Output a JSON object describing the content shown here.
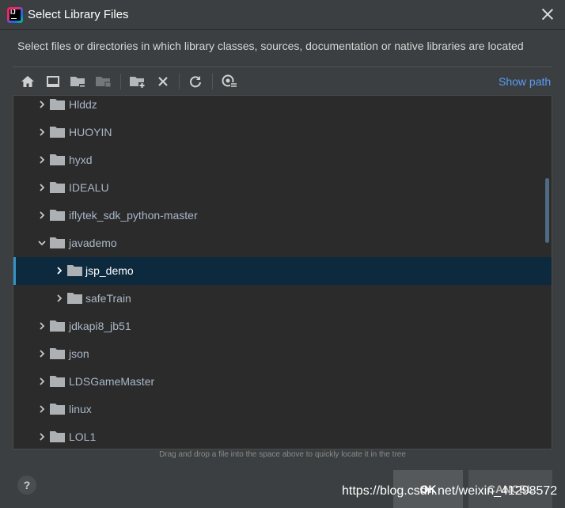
{
  "window": {
    "title": "Select Library Files",
    "description": "Select files or directories in which library classes, sources, documentation or native libraries are located"
  },
  "toolbar": {
    "buttons": [
      {
        "name": "home-icon"
      },
      {
        "name": "desktop-icon"
      },
      {
        "name": "project-folder-icon"
      },
      {
        "name": "module-folder-icon"
      },
      {
        "name": "new-folder-icon"
      },
      {
        "name": "delete-icon"
      },
      {
        "name": "refresh-icon"
      },
      {
        "name": "toggle-hidden-icon"
      }
    ],
    "show_path_label": "Show path"
  },
  "tree": {
    "items": [
      {
        "label": "Hlddz",
        "depth": 0,
        "expanded": false
      },
      {
        "label": "HUOYIN",
        "depth": 0,
        "expanded": false
      },
      {
        "label": "hyxd",
        "depth": 0,
        "expanded": false
      },
      {
        "label": "IDEALU",
        "depth": 0,
        "expanded": false
      },
      {
        "label": "iflytek_sdk_python-master",
        "depth": 0,
        "expanded": false
      },
      {
        "label": "javademo",
        "depth": 0,
        "expanded": true
      },
      {
        "label": "jsp_demo",
        "depth": 1,
        "expanded": false,
        "selected": true
      },
      {
        "label": "safeTrain",
        "depth": 1,
        "expanded": false
      },
      {
        "label": "jdkapi8_jb51",
        "depth": 0,
        "expanded": false
      },
      {
        "label": "json",
        "depth": 0,
        "expanded": false
      },
      {
        "label": "LDSGameMaster",
        "depth": 0,
        "expanded": false
      },
      {
        "label": "linux",
        "depth": 0,
        "expanded": false
      },
      {
        "label": "LOL1",
        "depth": 0,
        "expanded": false
      }
    ]
  },
  "hint": "Drag and drop a file into the space above to quickly locate it in the tree",
  "footer": {
    "help_label": "?",
    "ok_label": "OK",
    "cancel_label": "CANCEL",
    "watermark": "https://blog.csdn.net/weixin_41298572"
  },
  "colors": {
    "background": "#3c3f41",
    "tree_background": "#2b2b2b",
    "selection": "#0d293e",
    "link": "#589df6"
  }
}
